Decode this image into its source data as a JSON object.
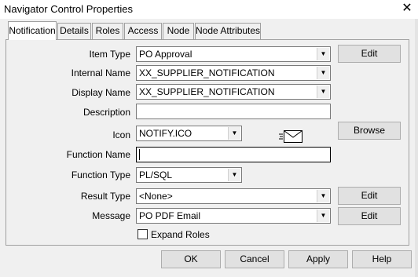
{
  "window": {
    "title": "Navigator Control Properties",
    "close_glyph": "✕"
  },
  "tabs": [
    "Notification",
    "Details",
    "Roles",
    "Access",
    "Node",
    "Node Attributes"
  ],
  "form": {
    "item_type": {
      "label": "Item Type",
      "value": "PO Approval"
    },
    "internal_name": {
      "label": "Internal Name",
      "value": "XX_SUPPLIER_NOTIFICATION"
    },
    "display_name": {
      "label": "Display Name",
      "value": "XX_SUPPLIER_NOTIFICATION"
    },
    "description": {
      "label": "Description",
      "value": ""
    },
    "icon": {
      "label": "Icon",
      "value": "NOTIFY.ICO",
      "preview_icon": "envelope-icon"
    },
    "function_name": {
      "label": "Function Name",
      "value": ""
    },
    "function_type": {
      "label": "Function Type",
      "value": "PL/SQL"
    },
    "result_type": {
      "label": "Result Type",
      "value": "<None>"
    },
    "message": {
      "label": "Message",
      "value": "PO PDF Email"
    },
    "expand_roles": {
      "label": "Expand Roles",
      "checked": false
    }
  },
  "side_buttons": {
    "edit": "Edit",
    "browse": "Browse"
  },
  "dialog_buttons": {
    "ok": "OK",
    "cancel": "Cancel",
    "apply": "Apply",
    "help": "Help"
  }
}
